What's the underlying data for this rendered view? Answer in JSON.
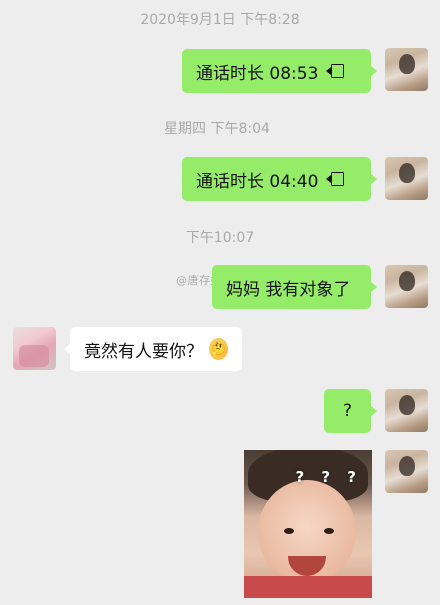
{
  "messages": {
    "ts1": "2020年9月1日 下午8:28",
    "call1": "通话时长 08:53",
    "ts2": "星期四 下午8:04",
    "call2": "通话时长 04:40",
    "ts3": "下午10:07",
    "msg_mom": "妈妈 我有对象了",
    "reply": "竟然有人要你？",
    "question": "?",
    "sticker_marks": "? ? ?"
  },
  "watermark": "@唐存好不停思",
  "icons": {
    "call": "video-call-icon",
    "emoji": "thinking-face-emoji"
  },
  "colors": {
    "background": "#ededed",
    "sent_bubble": "#95ec69",
    "received_bubble": "#ffffff",
    "timestamp_text": "#a9a9a9"
  }
}
